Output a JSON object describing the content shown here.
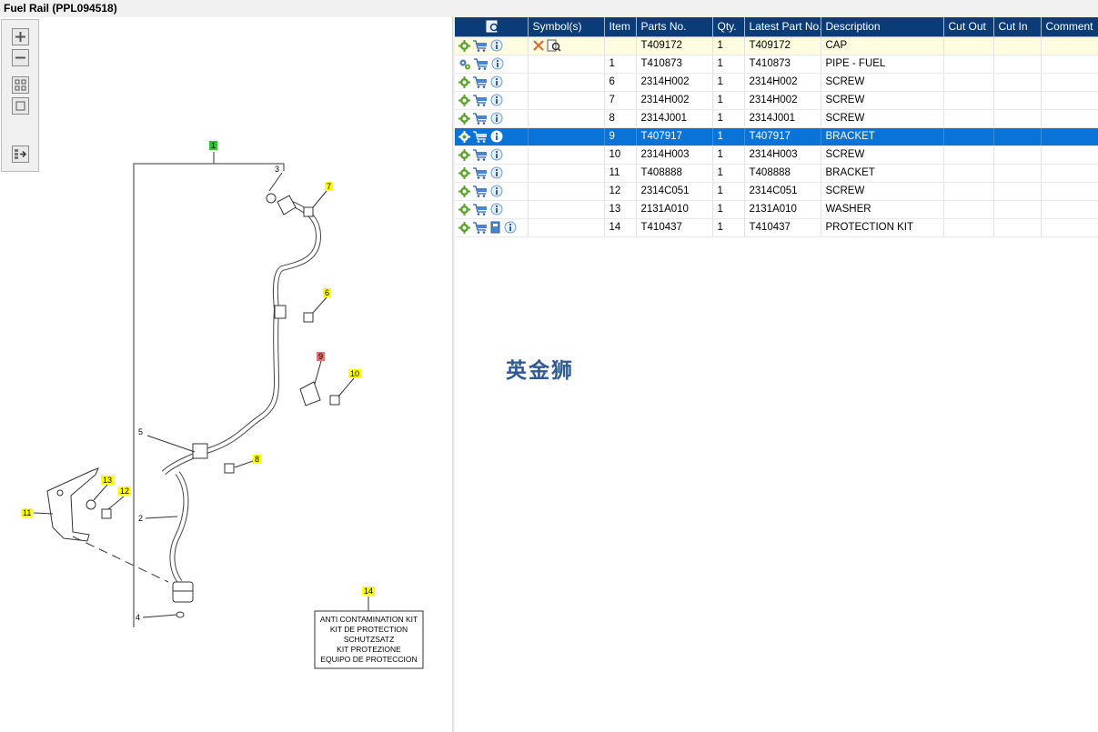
{
  "window": {
    "title": "Fuel Rail (PPL094518)"
  },
  "toolbox": {
    "buttons": [
      "zoom-in",
      "zoom-out",
      "fit-all",
      "fit-window",
      "show-list"
    ]
  },
  "diagram": {
    "callouts": [
      {
        "label": "1",
        "color": "#22cc22"
      },
      {
        "label": "3"
      },
      {
        "label": "7",
        "color": "#ffff00"
      },
      {
        "label": "6",
        "color": "#ffff00"
      },
      {
        "label": "9",
        "color": "#e87070"
      },
      {
        "label": "10",
        "color": "#ffff00"
      },
      {
        "label": "5"
      },
      {
        "label": "8",
        "color": "#ffff00"
      },
      {
        "label": "13",
        "color": "#ffff00"
      },
      {
        "label": "12",
        "color": "#ffff00"
      },
      {
        "label": "11",
        "color": "#ffff00"
      },
      {
        "label": "2"
      },
      {
        "label": "14",
        "color": "#ffff00"
      },
      {
        "label": "4"
      }
    ],
    "kit_box": [
      "ANTI CONTAMINATION KIT",
      "KIT DE PROTECTION",
      "SCHUTZSATZ",
      "KIT PROTEZIONE",
      "EQUIPO DE PROTECCION"
    ]
  },
  "table": {
    "columns": [
      "",
      "Symbol(s)",
      "Item",
      "Parts No.",
      "Qty.",
      "Latest Part No.",
      "Description",
      "Cut Out",
      "Cut In",
      "Comment"
    ],
    "rows": [
      {
        "item": "",
        "part": "T409172",
        "qty": "1",
        "latest": "T409172",
        "desc": "CAP",
        "symbols": true
      },
      {
        "item": "1",
        "part": "T410873",
        "qty": "1",
        "latest": "T410873",
        "desc": "PIPE - FUEL",
        "gears": true
      },
      {
        "item": "6",
        "part": "2314H002",
        "qty": "1",
        "latest": "2314H002",
        "desc": "SCREW"
      },
      {
        "item": "7",
        "part": "2314H002",
        "qty": "1",
        "latest": "2314H002",
        "desc": "SCREW"
      },
      {
        "item": "8",
        "part": "2314J001",
        "qty": "1",
        "latest": "2314J001",
        "desc": "SCREW"
      },
      {
        "item": "9",
        "part": "T407917",
        "qty": "1",
        "latest": "T407917",
        "desc": "BRACKET",
        "selected": true
      },
      {
        "item": "10",
        "part": "2314H003",
        "qty": "1",
        "latest": "2314H003",
        "desc": "SCREW"
      },
      {
        "item": "11",
        "part": "T408888",
        "qty": "1",
        "latest": "T408888",
        "desc": "BRACKET"
      },
      {
        "item": "12",
        "part": "2314C051",
        "qty": "1",
        "latest": "2314C051",
        "desc": "SCREW"
      },
      {
        "item": "13",
        "part": "2131A010",
        "qty": "1",
        "latest": "2131A010",
        "desc": "WASHER"
      },
      {
        "item": "14",
        "part": "T410437",
        "qty": "1",
        "latest": "T410437",
        "desc": "PROTECTION KIT",
        "book": true
      }
    ]
  },
  "watermark": "英金狮",
  "colors": {
    "header": "#0a3c78",
    "selected": "#0a73d7",
    "first_row": "#fffde0"
  }
}
